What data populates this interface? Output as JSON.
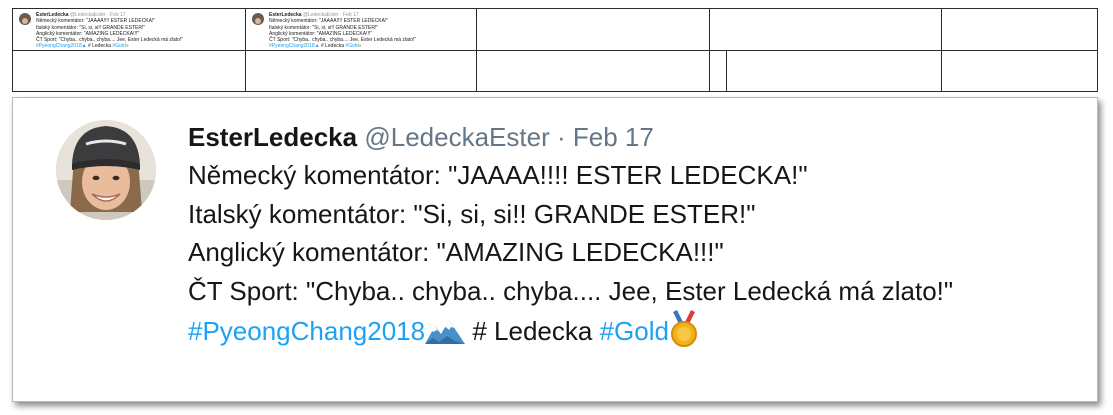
{
  "tweet": {
    "display_name": "EsterLedecka",
    "handle": "@LedeckaEster",
    "separator": "·",
    "date": "Feb 17",
    "lines": [
      "Německý komentátor: \"JAAAA!!!! ESTER LEDECKA!\"",
      "Italský komentátor: \"Si, si, si!! GRANDE ESTER!\"",
      "Anglický komentátor: \"AMAZING LEDECKA!!!\"",
      "ČT Sport: \"Chyba.. chyba.. chyba.... Jee, Ester Ledecká má zlato!\""
    ],
    "hashtag_pyeongchang": "#PyeongChang2018",
    "hash_space": "# Ledecka",
    "hashtag_gold": "#Gold"
  },
  "thumbnail_small": {
    "display_name": "EsterLedecka",
    "handle": "@LedeckaEster",
    "date": "· Feb 17",
    "lines": [
      "Německý komentátor: \"JAAAA!!!! ESTER LEDECKA!\"",
      "Italský komentátor: \"Si, si, si!! GRANDE ESTER!\"",
      "Anglický komentátor: \"AMAZING LEDECKA!!!\"",
      "ČT Sport: \"Chyba.. chyba.. chyba.... Jee, Ester Ledecká má zlato!\""
    ],
    "hashtag_pyeongchang": "#PyeongChang2018",
    "hash_space": "# Ledecka",
    "hashtag_gold": "#Gold"
  },
  "colors": {
    "hashtag": "#1da1f2",
    "muted": "#657786",
    "text": "#14171a",
    "medal": "#f2b21a"
  },
  "icons": [
    "mountain-snow-icon",
    "gold-medal-icon"
  ]
}
